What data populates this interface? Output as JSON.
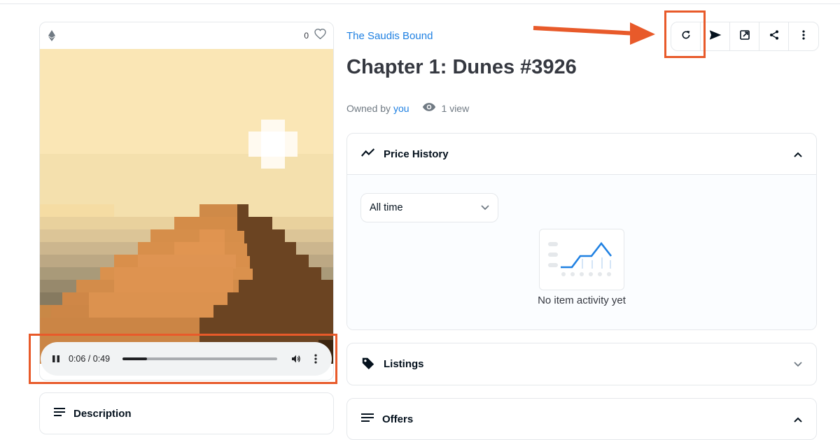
{
  "collection": {
    "name": "The Saudis Bound"
  },
  "item": {
    "title": "Chapter 1: Dunes #3926",
    "owned_prefix": "Owned by",
    "owner": "you",
    "views": "1 view"
  },
  "media": {
    "favorites": "0"
  },
  "player": {
    "current": "0:06",
    "duration": "0:49",
    "time_text": "0:06 / 0:49",
    "progress": 0.16
  },
  "toolbar": {
    "icons": [
      "refresh-icon",
      "send-icon",
      "external-link-icon",
      "share-icon",
      "more-vertical-icon"
    ]
  },
  "price_history": {
    "label": "Price History",
    "filter": "All time",
    "empty": "No item activity yet"
  },
  "listings": {
    "label": "Listings"
  },
  "offers": {
    "label": "Offers"
  },
  "description": {
    "label": "Description"
  },
  "colors": {
    "accent": "#2081e2",
    "annotation": "#e85a2a"
  }
}
